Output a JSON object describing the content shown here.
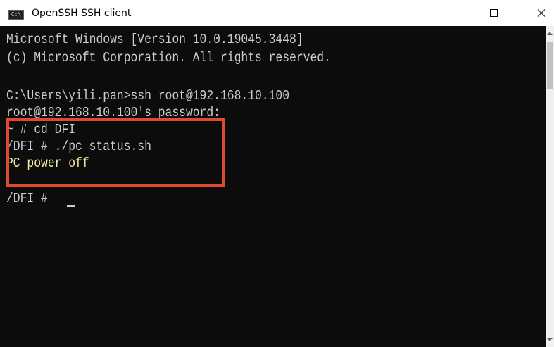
{
  "window": {
    "title": "OpenSSH SSH client",
    "icon": "console-app-icon",
    "icon_text": "C:\\"
  },
  "controls": {
    "minimize_icon": "minimize-icon",
    "maximize_icon": "maximize-icon",
    "close_icon": "close-icon"
  },
  "console": {
    "background_color": "#0c0c0c",
    "text_color": "#cccccc",
    "highlight_text_color": "#f9f1a5",
    "lines": [
      "Microsoft Windows [Version 10.0.19045.3448]",
      "(c) Microsoft Corporation. All rights reserved.",
      "",
      "C:\\Users\\yili.pan>ssh root@192.168.10.100",
      "root@192.168.10.100's password:",
      "~ # cd DFI",
      "/DFI # ./pc_status.sh",
      "PC power off",
      "",
      "/DFI # "
    ]
  },
  "annotation": {
    "box_color": "#e04a2f"
  }
}
